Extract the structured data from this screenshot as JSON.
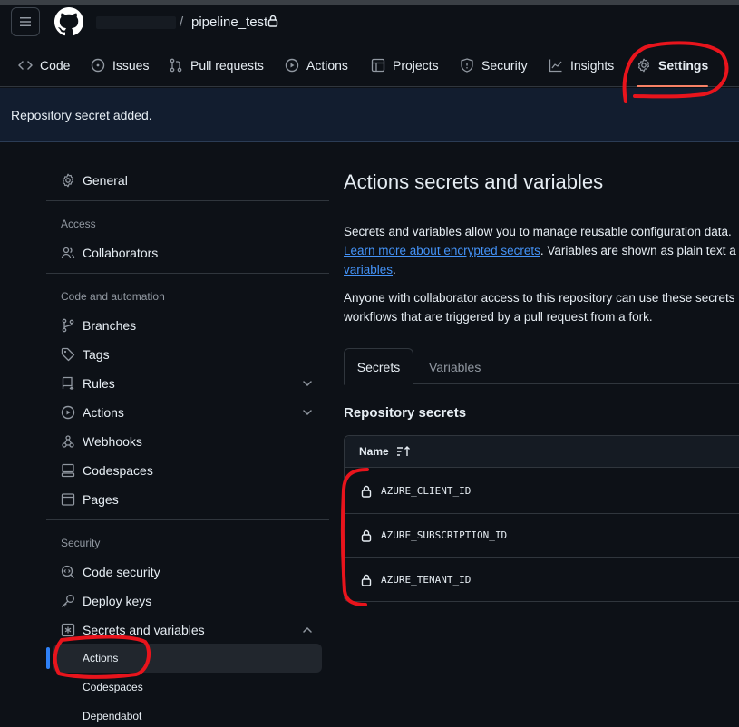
{
  "header": {
    "repo_name": "pipeline_test",
    "separator": "/"
  },
  "repo_nav": {
    "items": [
      {
        "label": "Code",
        "icon": "code-icon"
      },
      {
        "label": "Issues",
        "icon": "issue-opened-icon"
      },
      {
        "label": "Pull requests",
        "icon": "git-pull-request-icon"
      },
      {
        "label": "Actions",
        "icon": "play-icon"
      },
      {
        "label": "Projects",
        "icon": "table-icon"
      },
      {
        "label": "Security",
        "icon": "shield-icon"
      },
      {
        "label": "Insights",
        "icon": "graph-icon"
      },
      {
        "label": "Settings",
        "icon": "gear-icon",
        "active": true
      }
    ]
  },
  "flash": {
    "message": "Repository secret added."
  },
  "sidebar": {
    "general": "General",
    "access_heading": "Access",
    "collaborators": "Collaborators",
    "code_automation_heading": "Code and automation",
    "branches": "Branches",
    "tags": "Tags",
    "rules": "Rules",
    "actions": "Actions",
    "webhooks": "Webhooks",
    "codespaces": "Codespaces",
    "pages": "Pages",
    "security_heading": "Security",
    "code_security": "Code security",
    "deploy_keys": "Deploy keys",
    "secrets_and_variables": "Secrets and variables",
    "sub_actions": "Actions",
    "sub_codespaces": "Codespaces",
    "sub_dependabot": "Dependabot"
  },
  "main": {
    "title": "Actions secrets and variables",
    "desc1_line1": "Secrets and variables allow you to manage reusable configuration data.",
    "desc1_link1": "Learn more about encrypted secrets",
    "desc1_line2_rest": ". Variables are shown as plain text a",
    "desc1_link2": "variables",
    "desc1_line3_rest": ".",
    "desc2_line1": "Anyone with collaborator access to this repository can use these secrets",
    "desc2_line2": "workflows that are triggered by a pull request from a fork.",
    "tabs": [
      {
        "label": "Secrets",
        "active": true
      },
      {
        "label": "Variables",
        "active": false
      }
    ],
    "section_title": "Repository secrets",
    "table": {
      "name_header": "Name",
      "rows": [
        {
          "name": "AZURE_CLIENT_ID"
        },
        {
          "name": "AZURE_SUBSCRIPTION_ID"
        },
        {
          "name": "AZURE_TENANT_ID"
        }
      ]
    }
  },
  "colors": {
    "background": "#0d1117",
    "accent_link": "#4493f8",
    "active_underline": "#f78166",
    "annotation_red": "#e8141c"
  }
}
